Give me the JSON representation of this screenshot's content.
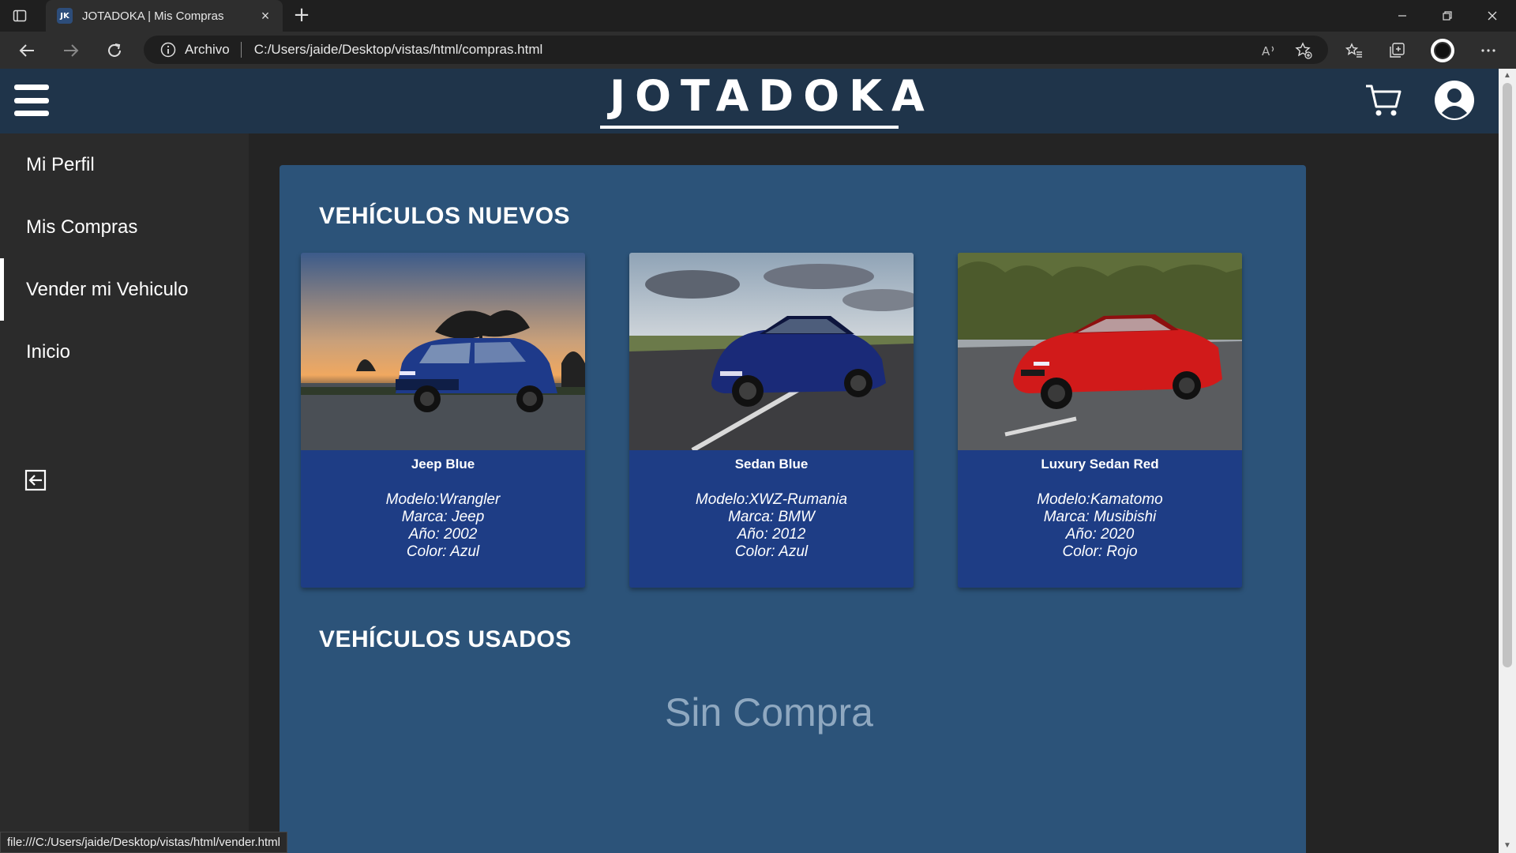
{
  "browser": {
    "tab_favicon": "JK",
    "tab_title": "JOTADOKA | Mis Compras",
    "tab_close": "×",
    "new_tab": "+",
    "url_scheme": "Archivo",
    "url": "C:/Users/jaide/Desktop/vistas/html/compras.html",
    "status_url": "file:///C:/Users/jaide/Desktop/vistas/html/vender.html"
  },
  "header": {
    "brand": "JOTADOKA"
  },
  "sidebar": {
    "items": [
      {
        "label": "Mi Perfil",
        "active": false
      },
      {
        "label": "Mis Compras",
        "active": false
      },
      {
        "label": "Vender mi Vehiculo",
        "active": true
      },
      {
        "label": "Inicio",
        "active": false
      }
    ],
    "logout_icon": "logout-icon"
  },
  "main": {
    "new_title": "VEHÍCULOS NUEVOS",
    "used_title": "VEHÍCULOS USADOS",
    "empty_text": "Sin Compra",
    "vehicles": [
      {
        "name": "Jeep Blue",
        "modelo": "Modelo:Wrangler",
        "marca": "Marca: Jeep",
        "anio": "Año: 2002",
        "color": "Color: Azul",
        "car_color": "#1e3a8a"
      },
      {
        "name": "Sedan Blue",
        "modelo": "Modelo:XWZ-Rumania",
        "marca": "Marca: BMW",
        "anio": "Año: 2012",
        "color": "Color: Azul",
        "car_color": "#1a2a78"
      },
      {
        "name": "Luxury Sedan Red",
        "modelo": "Modelo:Kamatomo",
        "marca": "Marca: Musibishi",
        "anio": "Año: 2020",
        "color": "Color: Rojo",
        "car_color": "#d11a1a"
      }
    ]
  },
  "colors": {
    "header_bg": "#1f344a",
    "sidebar_bg": "#2b2b2b",
    "main_card_bg": "#2c5379",
    "vehicle_card_bg": "#1e3d85",
    "empty_text": "#8fa8c0"
  }
}
